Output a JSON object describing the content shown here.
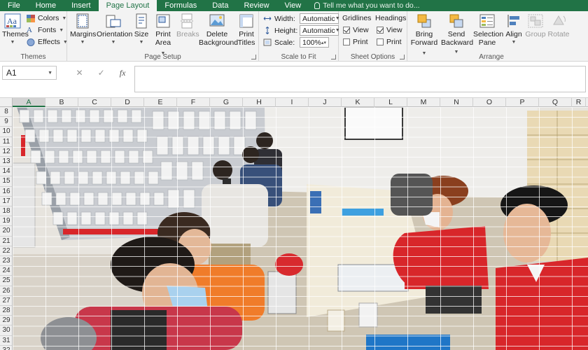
{
  "tabs": [
    "File",
    "Home",
    "Insert",
    "Page Layout",
    "Formulas",
    "Data",
    "Review",
    "View"
  ],
  "active_tab": "Page Layout",
  "tell_me": "Tell me what you want to do...",
  "ribbon": {
    "themes": {
      "themes_label": "Themes",
      "colors_label": "Colors",
      "fonts_label": "Fonts",
      "effects_label": "Effects",
      "group_label": "Themes"
    },
    "page_setup": {
      "margins": "Margins",
      "orientation": "Orientation",
      "size": "Size",
      "print_area_1": "Print",
      "print_area_2": "Area",
      "breaks": "Breaks",
      "delete_bg_1": "Delete",
      "delete_bg_2": "Background",
      "print_titles_1": "Print",
      "print_titles_2": "Titles",
      "group_label": "Page Setup"
    },
    "scale_to_fit": {
      "width_label": "Width:",
      "width_value": "Automatic",
      "height_label": "Height:",
      "height_value": "Automatic",
      "scale_label": "Scale:",
      "scale_value": "100%",
      "group_label": "Scale to Fit"
    },
    "sheet_options": {
      "gridlines": "Gridlines",
      "headings": "Headings",
      "view": "View",
      "print": "Print",
      "group_label": "Sheet Options"
    },
    "arrange": {
      "bring_forward_1": "Bring",
      "bring_forward_2": "Forward",
      "send_backward_1": "Send",
      "send_backward_2": "Backward",
      "selection_pane_1": "Selection",
      "selection_pane_2": "Pane",
      "align": "Align",
      "group": "Group",
      "rotate": "Rotate",
      "group_label": "Arrange"
    }
  },
  "formula_bar": {
    "name_box": "A1",
    "cancel": "✕",
    "enter": "✓",
    "fx": "fx",
    "content": ""
  },
  "columns": [
    "A",
    "B",
    "C",
    "D",
    "E",
    "F",
    "G",
    "H",
    "I",
    "J",
    "K",
    "L",
    "M",
    "N",
    "O",
    "P",
    "Q",
    "R"
  ],
  "rows": [
    "8",
    "9",
    "10",
    "11",
    "12",
    "13",
    "14",
    "15",
    "16",
    "17",
    "18",
    "19",
    "20",
    "21",
    "22",
    "23",
    "24",
    "25",
    "26",
    "27",
    "28",
    "29",
    "30",
    "31",
    "32"
  ],
  "colors": {
    "excel_green": "#217346",
    "uniform_red": "#d8262a",
    "hoodie_pink": "#c8374a",
    "shirt_orange": "#f07c2a"
  }
}
